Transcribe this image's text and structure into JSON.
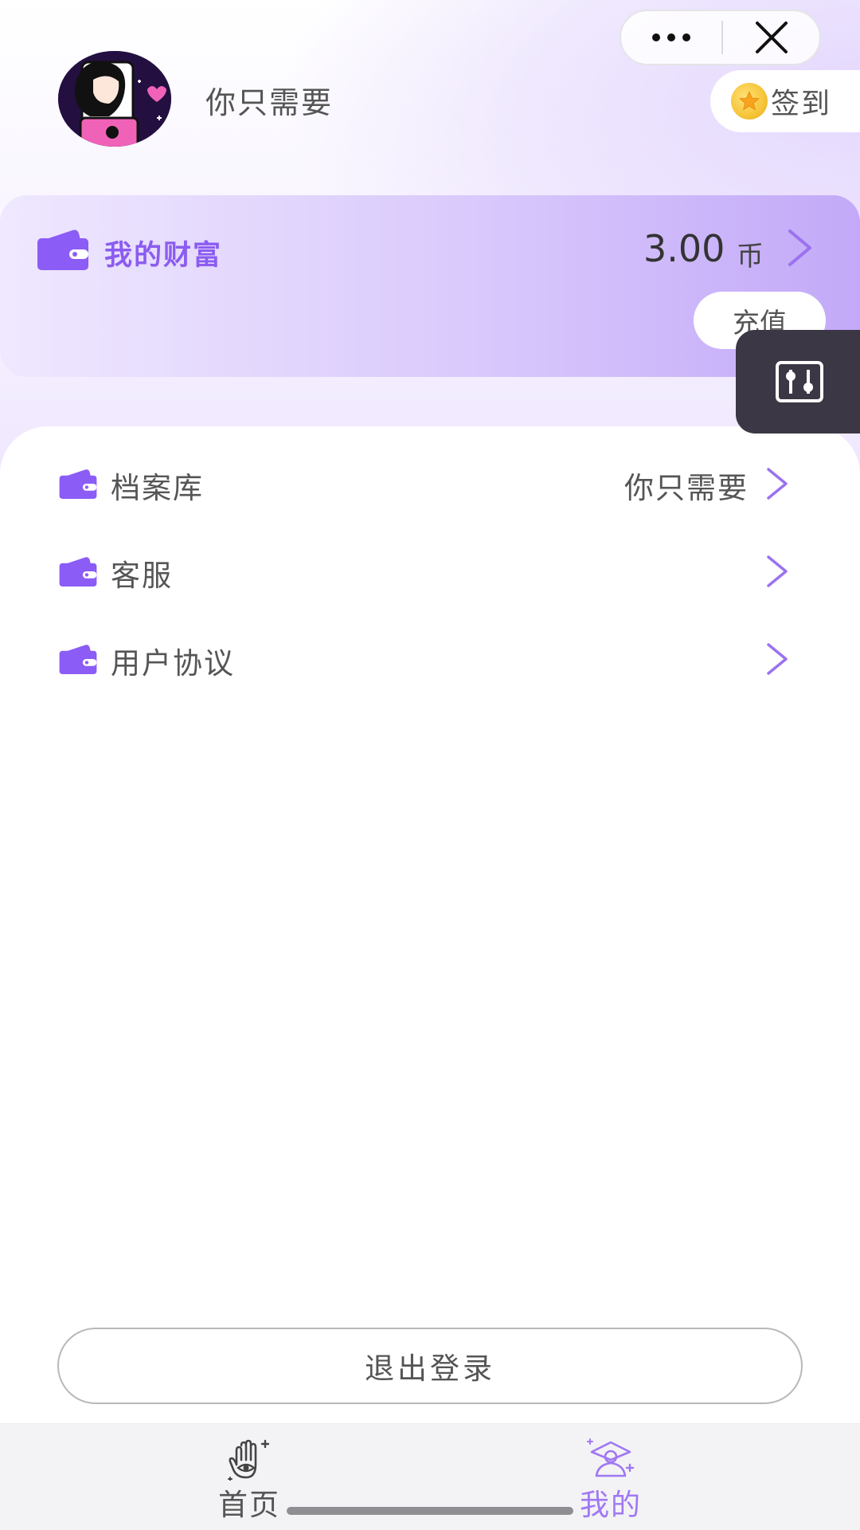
{
  "capsule": {
    "more_icon": "more-dots-icon",
    "close_icon": "close-icon"
  },
  "profile": {
    "username": "你只需要"
  },
  "signin": {
    "label": "签到",
    "icon": "coin-star-icon"
  },
  "wealth": {
    "title": "我的财富",
    "amount": "3.00",
    "unit": "币",
    "recharge_label": "充值",
    "icon": "wallet-icon"
  },
  "menu": {
    "items": [
      {
        "label": "档案库",
        "value": "你只需要"
      },
      {
        "label": "客服",
        "value": ""
      },
      {
        "label": "用户协议",
        "value": ""
      }
    ]
  },
  "logout": {
    "label": "退出登录"
  },
  "tabbar": {
    "tabs": [
      {
        "label": "首页",
        "active": false,
        "icon": "palm-eye-icon"
      },
      {
        "label": "我的",
        "active": true,
        "icon": "fortune-teller-icon"
      }
    ],
    "active_color": "#a078f2",
    "inactive_color": "#555555"
  },
  "colors": {
    "accent": "#8b5cf0",
    "wallet": "#8b5cf6",
    "floating_tool_bg": "#3b3744"
  }
}
